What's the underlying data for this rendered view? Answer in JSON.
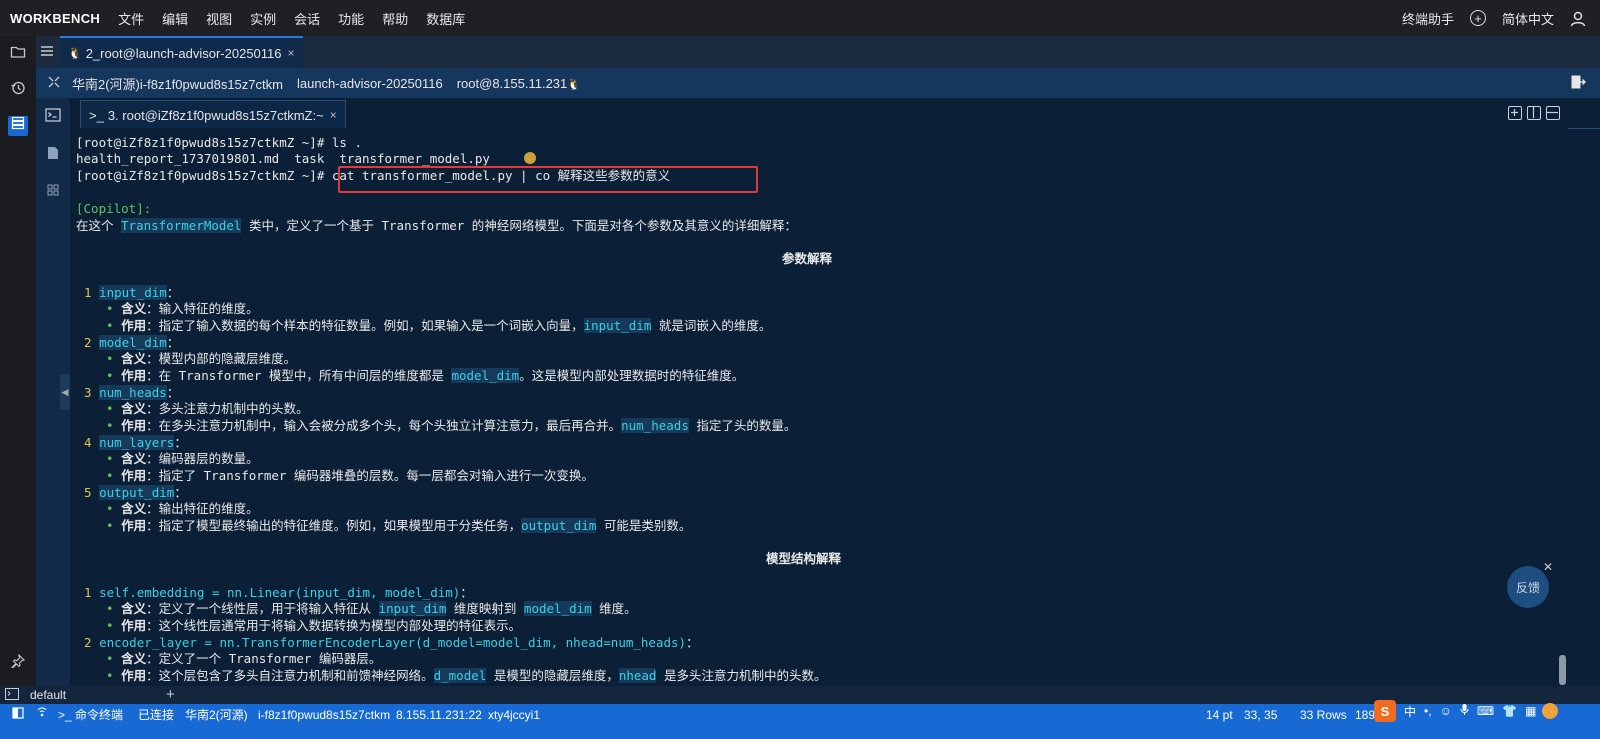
{
  "menubar": {
    "brand": "WORKBENCH",
    "items": [
      "文件",
      "编辑",
      "视图",
      "实例",
      "会话",
      "功能",
      "帮助",
      "数据库"
    ],
    "assistant": "终端助手",
    "language": "简体中文"
  },
  "tab": {
    "label": "2_root@launch-advisor-20250116",
    "close": "×"
  },
  "session": {
    "region": "华南2(河源)i-f8z1f0pwud8s15z7ctkm",
    "name": "launch-advisor-20250116",
    "user": "root@8.155.11.231"
  },
  "inner_tab": {
    "label": "3. root@iZf8z1f0pwud8s15z7ctkmZ:~",
    "close": "×"
  },
  "terminal": {
    "prompt": "[root@iZf8z1f0pwud8s15z7ctkmZ ~]# ",
    "cmd1": "ls .",
    "ls_out1": "health_report_1737019801.md  task  ",
    "ls_out2": "transformer_model.py",
    "cmd2": "cat transformer_model.py | co 解释这些参数的意义",
    "copilot": "[Copilot]:",
    "intro_a": "在这个 ",
    "intro_code": "TransformerModel",
    "intro_b": " 类中，定义了一个基于 Transformer 的神经网络模型。下面是对各个参数及其意义的详细解释：",
    "section1": "参数解释",
    "section2": "模型结构解释",
    "params": [
      {
        "num": "1",
        "name": "input_dim",
        "meaning": "输入特征的维度。",
        "role_a": "指定了输入数据的每个样本的特征数量。例如，如果输入是一个词嵌入向量，",
        "role_code": "input_dim",
        "role_b": " 就是词嵌入的维度。"
      },
      {
        "num": "2",
        "name": "model_dim",
        "meaning": "模型内部的隐藏层维度。",
        "role_a": "在 Transformer 模型中，所有中间层的维度都是 ",
        "role_code": "model_dim",
        "role_b": "。这是模型内部处理数据时的特征维度。"
      },
      {
        "num": "3",
        "name": "num_heads",
        "meaning": "多头注意力机制中的头数。",
        "role_a": "在多头注意力机制中，输入会被分成多个头，每个头独立计算注意力，最后再合并。",
        "role_code": "num_heads",
        "role_b": " 指定了头的数量。"
      },
      {
        "num": "4",
        "name": "num_layers",
        "meaning": "编码器层的数量。",
        "role_a": "指定了 Transformer 编码器堆叠的层数。每一层都会对输入进行一次变换。",
        "role_code": "",
        "role_b": ""
      },
      {
        "num": "5",
        "name": "output_dim",
        "meaning": "输出特征的维度。",
        "role_a": "指定了模型最终输出的特征维度。例如，如果模型用于分类任务，",
        "role_code": "output_dim",
        "role_b": " 可能是类别数。"
      }
    ],
    "struct": [
      {
        "num": "1",
        "name": "self.embedding = nn.Linear(input_dim, model_dim)",
        "meaning_a": "定义了一个线性层，用于将输入特征从 ",
        "meaning_c1": "input_dim",
        "meaning_b": " 维度映射到 ",
        "meaning_c2": "model_dim",
        "meaning_c": " 维度。",
        "role_a": "这个线性层通常用于将输入数据转换为模型内部处理的特征表示。",
        "role_c1": "",
        "role_b": "",
        "role_c2": "",
        "role_c": ""
      },
      {
        "num": "2",
        "name": "encoder_layer = nn.TransformerEncoderLayer(d_model=model_dim, nhead=num_heads)",
        "meaning_a": "定义了一个 Transformer 编码器层。",
        "meaning_c1": "",
        "meaning_b": "",
        "meaning_c2": "",
        "meaning_c": "",
        "role_a": "这个层包含了多头自注意力机制和前馈神经网络。",
        "role_c1": "d_model",
        "role_b": " 是模型的隐藏层维度，",
        "role_c2": "nhead",
        "role_c": " 是多头注意力机制中的头数。"
      }
    ],
    "meaning_label": "含义",
    "role_label": "作用",
    "colon": "："
  },
  "feedback": "反馈",
  "session_footer": "default",
  "status": {
    "terminal": "命令终端",
    "connected": "已连接",
    "region": "华南2(河源)",
    "instance": "i-f8z1f0pwud8s15z7ctkm",
    "ip": "8.155.11.231:22",
    "id": "xty4jccyi1",
    "font_size": "14 pt",
    "cursor": "33, 35",
    "rows": "33 Rows",
    "cols": "189"
  },
  "colors": {
    "accent": "#1769d4",
    "code": "#3ad0e6",
    "number": "#e5c44a",
    "bullet": "#5cc25c",
    "highlight_box": "#e03a3a"
  }
}
